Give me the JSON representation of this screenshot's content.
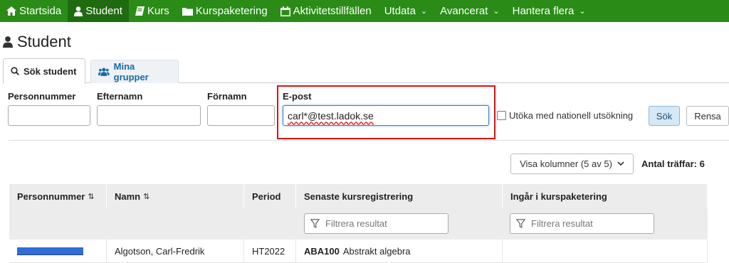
{
  "nav": {
    "items": [
      {
        "label": "Startsida",
        "icon": "home-icon"
      },
      {
        "label": "Student",
        "icon": "user-icon",
        "active": true
      },
      {
        "label": "Kurs",
        "icon": "book-icon"
      },
      {
        "label": "Kurspaketering",
        "icon": "folder-icon"
      },
      {
        "label": "Aktivitetstillfällen",
        "icon": "calendar-icon"
      },
      {
        "label": "Utdata",
        "dropdown": true
      },
      {
        "label": "Avancerat",
        "dropdown": true
      },
      {
        "label": "Hantera flera",
        "dropdown": true
      }
    ]
  },
  "page": {
    "title": "Student"
  },
  "tabs": {
    "search": "Sök student",
    "groups": "Mina grupper"
  },
  "form": {
    "pnr_label": "Personnummer",
    "lastname_label": "Efternamn",
    "firstname_label": "Förnamn",
    "email_label": "E-post",
    "email_value": "carl*@test.ladok.se",
    "national_search_label": "Utöka med nationell utsökning",
    "search_button": "Sök",
    "clear_button": "Rensa"
  },
  "results": {
    "columns_button": "Visa kolumner (5 av 5)",
    "hits_label": "Antal träffar: 6",
    "headers": [
      "Personnummer",
      "Namn",
      "Period",
      "Senaste kursregistrering",
      "Ingår i kurspaketering"
    ],
    "filter_placeholder": "Filtrera resultat",
    "rows": [
      {
        "name": "Algotson, Carl-Fredrik",
        "period": "HT2022",
        "course_code": "ABA100",
        "course_name": "Abstrakt algebra",
        "package": ""
      }
    ]
  },
  "colors": {
    "nav_bg": "#2a8c17",
    "nav_active": "#1f6b10",
    "highlight": "#d81313",
    "link": "#1a6aa0"
  }
}
